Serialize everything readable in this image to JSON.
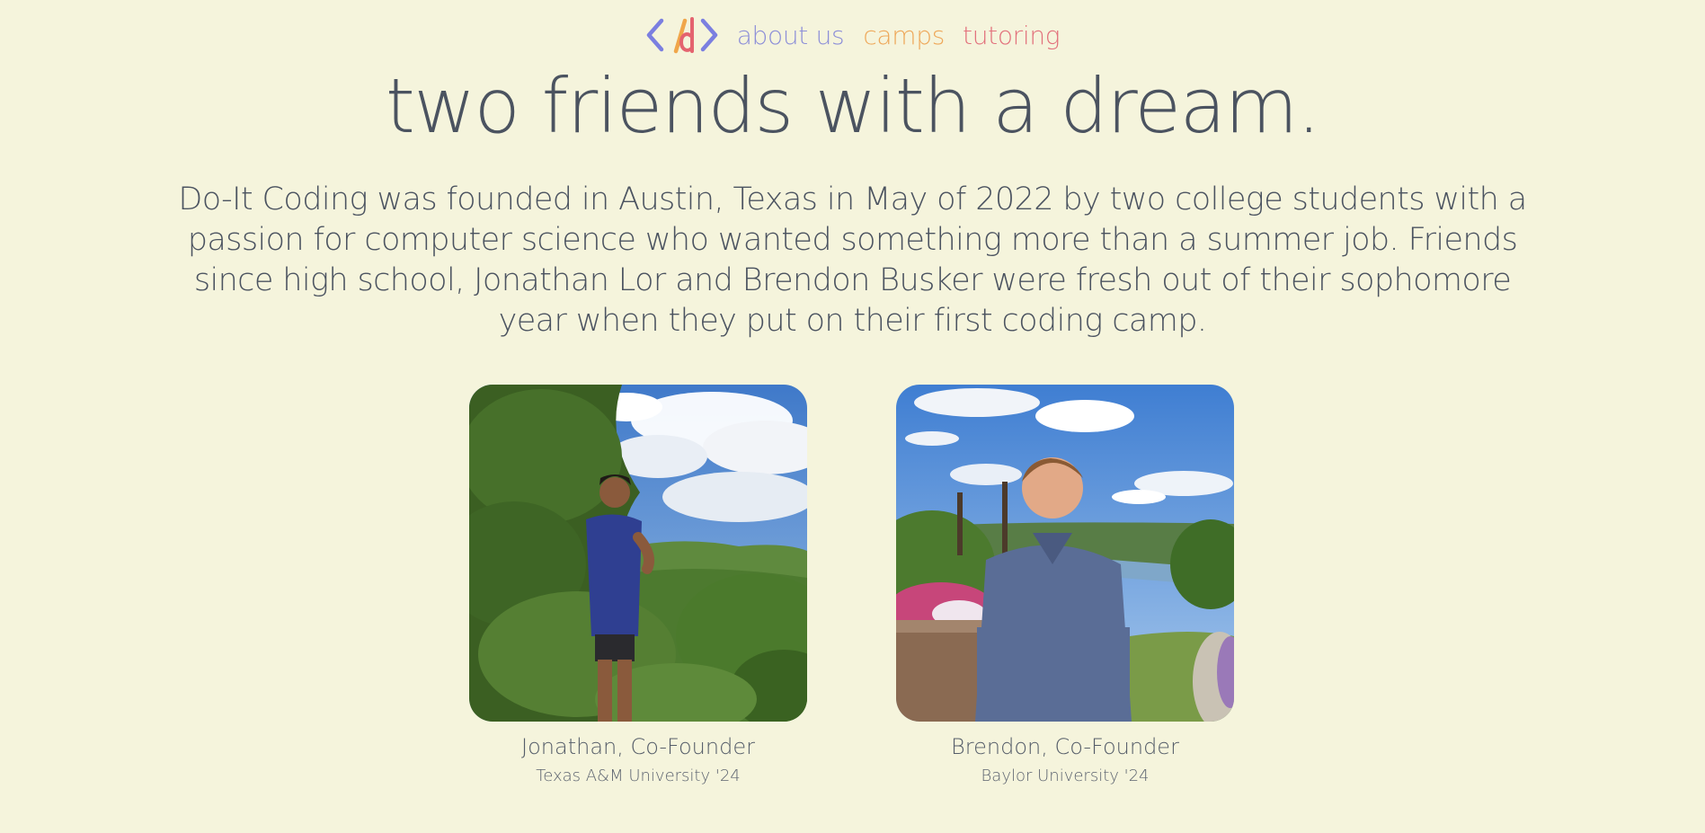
{
  "nav": {
    "logo_icon": "code-brackets-d-logo",
    "links": [
      {
        "label": "about us",
        "color": "#8d8fd8"
      },
      {
        "label": "camps",
        "color": "#eea85a"
      },
      {
        "label": "tutoring",
        "color": "#e2717c"
      }
    ]
  },
  "hero": {
    "title": "two friends with a dream.",
    "intro": "Do-It Coding was founded in Austin, Texas in May of 2022 by two college students with a passion for computer science who wanted something more than a summer job. Friends since high school, Jonathan Lor and Brendon Busker were fresh out of their sophomore year when they put on their first coding camp."
  },
  "founders": [
    {
      "name": "Jonathan, Co-Founder",
      "school": "Texas A&M University '24"
    },
    {
      "name": "Brendon, Co-Founder",
      "school": "Baylor University '24"
    }
  ],
  "colors": {
    "background": "#f5f4dc",
    "text": "#4b5360"
  }
}
